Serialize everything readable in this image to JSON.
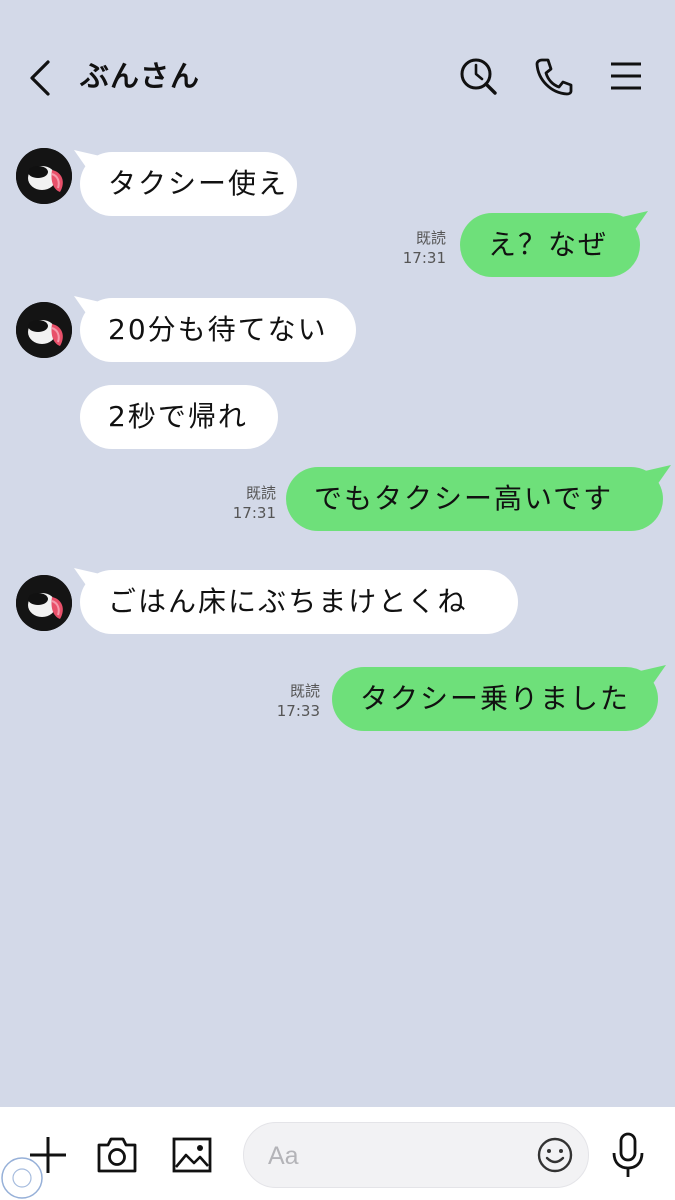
{
  "header": {
    "title": "ぶんさん",
    "icons": [
      "chevron-left-icon",
      "search-clock-icon",
      "phone-icon",
      "menu-icon"
    ]
  },
  "messages": [
    {
      "side": "in",
      "text": "タクシー使え",
      "avatar": true
    },
    {
      "side": "out",
      "text": "え？なぜ",
      "read": "既読",
      "time": "17:31"
    },
    {
      "side": "in",
      "text": "20分も待てない",
      "avatar": true
    },
    {
      "side": "in",
      "text": "2秒で帰れ",
      "avatar": false
    },
    {
      "side": "out",
      "text": "でもタクシー高いです",
      "read": "既読",
      "time": "17:31"
    },
    {
      "side": "in",
      "text": "ごはん床にぶちまけとくね",
      "avatar": true
    },
    {
      "side": "out",
      "text": "タクシー乗りました",
      "read": "既読",
      "time": "17:33"
    }
  ],
  "composer": {
    "placeholder": "Aa",
    "icons": [
      "plus-icon",
      "camera-icon",
      "image-icon",
      "emoji-icon",
      "microphone-icon"
    ]
  },
  "colors": {
    "background": "#d3d9e8",
    "incoming_bubble": "#ffffff",
    "outgoing_bubble": "#6ee07a"
  }
}
